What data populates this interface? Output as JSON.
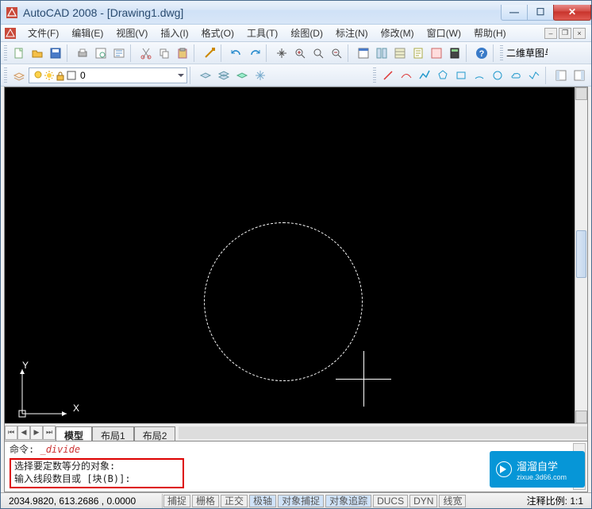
{
  "title": "AutoCAD 2008 - [Drawing1.dwg]",
  "menu": {
    "file": "文件(F)",
    "edit": "编辑(E)",
    "view": "视图(V)",
    "insert": "插入(I)",
    "format": "格式(O)",
    "tools": "工具(T)",
    "draw": "绘图(D)",
    "dimension": "标注(N)",
    "modify": "修改(M)",
    "window": "窗口(W)",
    "help": "帮助(H)"
  },
  "workspace_label": "二维草图与",
  "layer_dropdown": "0",
  "tabs": {
    "model": "模型",
    "layout1": "布局1",
    "layout2": "布局2"
  },
  "command": {
    "prefix": "命令:",
    "cmd_issued": "_divide",
    "line1": "选择要定数等分的对象:",
    "line2": "输入线段数目或 [块(B)]:"
  },
  "status": {
    "coords": "2034.9820, 613.2686 ,  0.0000",
    "snap": "捕捉",
    "grid": "栅格",
    "ortho": "正交",
    "polar": "极轴",
    "osnap": "对象捕捉",
    "otrack": "对象追踪",
    "ducs": "DUCS",
    "dyn": "DYN",
    "lwt": "线宽",
    "annoscale_label": "注释比例:",
    "annoscale_value": "1:1"
  },
  "axes": {
    "x": "X",
    "y": "Y"
  },
  "watermark": {
    "brand": "溜溜自学",
    "url": "zixue.3d66.com"
  },
  "win_controls": {
    "min": "—",
    "max": "☐",
    "close": "✕"
  }
}
